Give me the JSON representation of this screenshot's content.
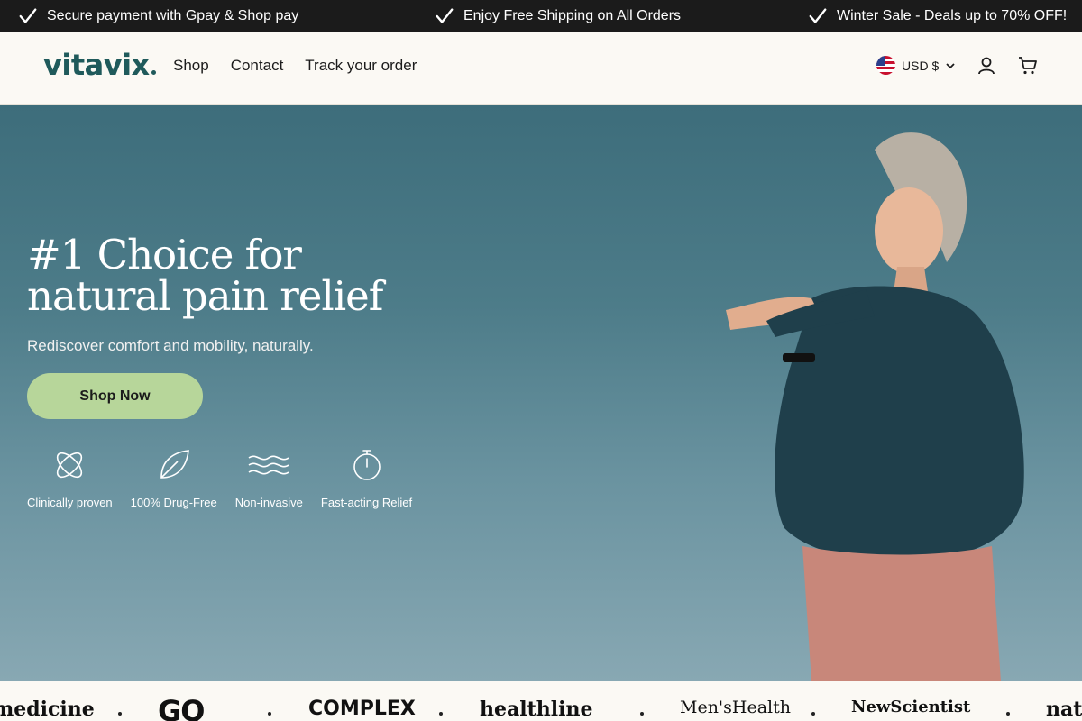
{
  "announcement": {
    "items": [
      "Secure payment with Gpay & Shop pay",
      "Enjoy Free Shipping on All Orders",
      "Winter Sale - Deals up to 70% OFF!"
    ],
    "icon": "checkmark-icon"
  },
  "header": {
    "logo": "vitavix",
    "nav": [
      "Shop",
      "Contact",
      "Track your order"
    ],
    "currency": "USD $",
    "icons": [
      "us-flag-icon",
      "chevron-down-icon",
      "account-icon",
      "cart-icon"
    ]
  },
  "hero": {
    "title_line1": "#1 Choice for",
    "title_line2": "natural pain relief",
    "subtitle": "Rediscover comfort and mobility, naturally.",
    "cta": "Shop Now",
    "features": [
      {
        "label": "Clinically proven",
        "icon": "atom-icon"
      },
      {
        "label": "100% Drug-Free",
        "icon": "leaf-icon"
      },
      {
        "label": "Non-invasive",
        "icon": "waves-icon"
      },
      {
        "label": "Fast-acting Relief",
        "icon": "stopwatch-icon"
      }
    ]
  },
  "press": {
    "logos": [
      "medicine",
      "GQ",
      "COMPLEX",
      "healthline",
      "Men'sHealth",
      "NewScientist",
      "natu"
    ]
  },
  "colors": {
    "announce_bg": "#1b1b1b",
    "brand": "#1f5a5b",
    "cta": "#b7d69a",
    "hero_bg": "#4d7c89"
  }
}
